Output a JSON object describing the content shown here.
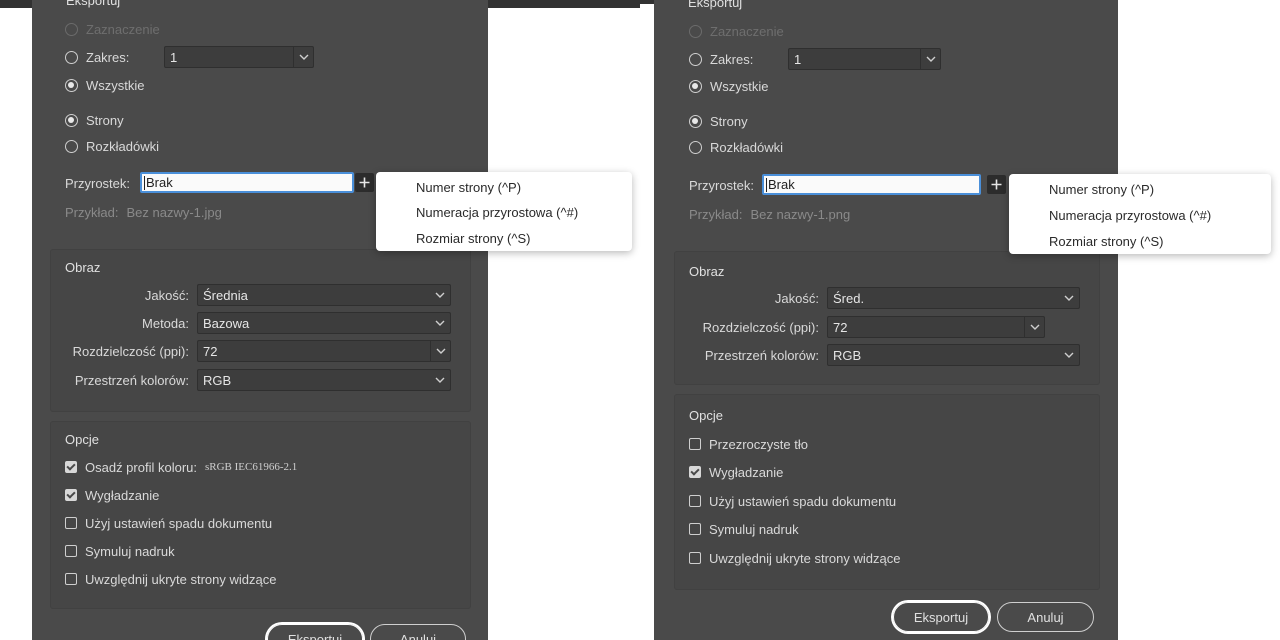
{
  "left": {
    "title": "Eksportuj",
    "range": {
      "selection": "Zaznaczenie",
      "range_label": "Zakres:",
      "range_value": "1",
      "all": "Wszystkie",
      "pages": "Strony",
      "spreads": "Rozkładówki"
    },
    "suffix": {
      "label": "Przyrostek:",
      "value": "Brak"
    },
    "example": {
      "label": "Przykład:",
      "value": "Bez nazwy-1.jpg"
    },
    "menu": [
      "Numer strony (^P)",
      "Numeracja przyrostowa (^#)",
      "Rozmiar strony (^S)"
    ],
    "image": {
      "title": "Obraz",
      "quality_label": "Jakość:",
      "quality_value": "Średnia",
      "method_label": "Metoda:",
      "method_value": "Bazowa",
      "resolution_label": "Rozdzielczość (ppi):",
      "resolution_value": "72",
      "colorspace_label": "Przestrzeń kolorów:",
      "colorspace_value": "RGB"
    },
    "options": {
      "title": "Opcje",
      "embed_profile": "Osadź profil koloru:",
      "profile_name": "sRGB IEC61966-2.1",
      "antialias": "Wygładzanie",
      "bleed": "Użyj ustawień spadu dokumentu",
      "overprint": "Symuluj nadruk",
      "hidden_pages": "Uwzględnij ukryte strony widzące"
    },
    "buttons": {
      "export": "Eksportuj",
      "cancel": "Anuluj"
    }
  },
  "right": {
    "title": "Eksportuj",
    "range": {
      "selection": "Zaznaczenie",
      "range_label": "Zakres:",
      "range_value": "1",
      "all": "Wszystkie",
      "pages": "Strony",
      "spreads": "Rozkładówki"
    },
    "suffix": {
      "label": "Przyrostek:",
      "value": "Brak"
    },
    "example": {
      "label": "Przykład:",
      "value": "Bez nazwy-1.png"
    },
    "menu": [
      "Numer strony (^P)",
      "Numeracja przyrostowa (^#)",
      "Rozmiar strony (^S)"
    ],
    "image": {
      "title": "Obraz",
      "quality_label": "Jakość:",
      "quality_value": "Śred.",
      "resolution_label": "Rozdzielczość (ppi):",
      "resolution_value": "72",
      "colorspace_label": "Przestrzeń kolorów:",
      "colorspace_value": "RGB"
    },
    "options": {
      "title": "Opcje",
      "transparent": "Przezroczyste tło",
      "antialias": "Wygładzanie",
      "bleed": "Użyj ustawień spadu dokumentu",
      "overprint": "Symuluj nadruk",
      "hidden_pages": "Uwzględnij ukryte strony widzące"
    },
    "buttons": {
      "export": "Eksportuj",
      "cancel": "Anuluj"
    }
  }
}
